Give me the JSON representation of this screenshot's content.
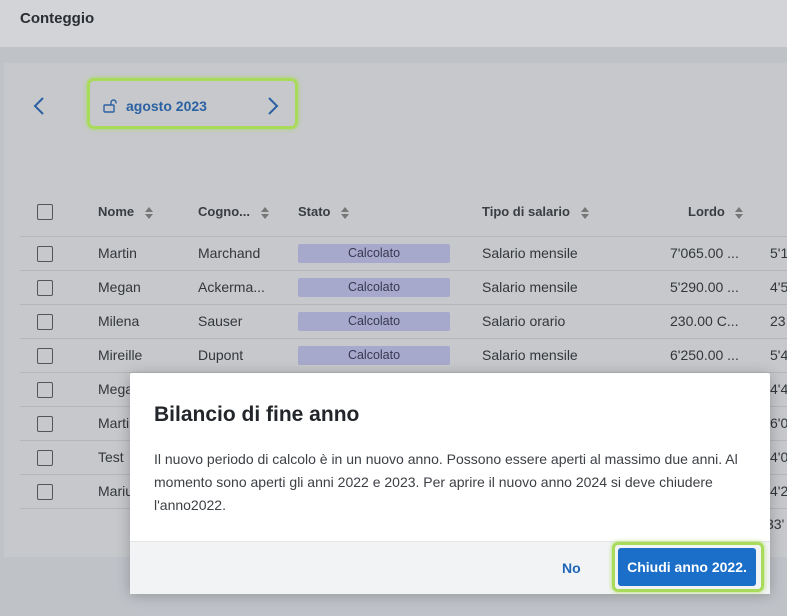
{
  "header": {
    "title": "Conteggio"
  },
  "period": {
    "label": "agosto 2023"
  },
  "table": {
    "columns": [
      "Nome",
      "Cognome",
      "Stato",
      "Tipo di salario",
      "Lordo"
    ],
    "column_display": [
      "Nome",
      "Cogno...",
      "Stato",
      "Tipo di salario",
      "Lordo"
    ],
    "rows": [
      {
        "nome": "Martin",
        "cognome": "Marchand",
        "stato": "Calcolato",
        "tipo": "Salario mensile",
        "lordo": "7'065.00 ...",
        "next": "5'1"
      },
      {
        "nome": "Megan",
        "cognome": "Ackerma...",
        "stato": "Calcolato",
        "tipo": "Salario mensile",
        "lordo": "5'290.00 ...",
        "next": "4'5"
      },
      {
        "nome": "Milena",
        "cognome": "Sauser",
        "stato": "Calcolato",
        "tipo": "Salario orario",
        "lordo": "230.00 C...",
        "next": "23"
      },
      {
        "nome": "Mireille",
        "cognome": "Dupont",
        "stato": "Calcolato",
        "tipo": "Salario mensile",
        "lordo": "6'250.00 ...",
        "next": "5'4"
      },
      {
        "nome": "Mega",
        "next": "4'4"
      },
      {
        "nome": "Marti",
        "next": "6'0"
      },
      {
        "nome": "Test",
        "next": "4'0"
      },
      {
        "nome": "Mariu",
        "next": "4'2"
      }
    ],
    "footer_partial": "33'"
  },
  "modal": {
    "title": "Bilancio di fine anno",
    "body": "Il nuovo periodo di calcolo è in un nuovo anno. Possono essere aperti al massimo due anni. Al momento sono aperti gli anni 2022 e 2023. Per aprire il nuovo anno 2024 si deve chiudere l'anno2022.",
    "no_label": "No",
    "confirm_label": "Chiudi anno 2022."
  },
  "colors": {
    "accent": "#1b6fc8",
    "highlight": "#a9db5b",
    "badge": "#a7a9cc"
  }
}
